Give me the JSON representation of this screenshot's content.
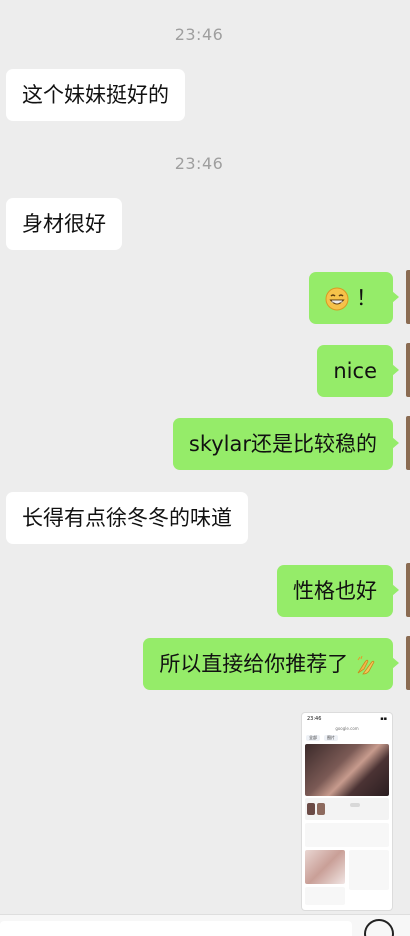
{
  "timestamps": [
    "23:46",
    "23:46"
  ],
  "messages": [
    {
      "side": "in",
      "text": "这个妹妹挺好的"
    },
    {
      "side": "in",
      "text": "身材很好"
    },
    {
      "side": "out",
      "text": "！",
      "emoji": "grinning-face"
    },
    {
      "side": "out",
      "text": "nice"
    },
    {
      "side": "out",
      "text": "skylar还是比较稳的"
    },
    {
      "side": "in",
      "text": "长得有点徐冬冬的味道"
    },
    {
      "side": "out",
      "text": "性格也好"
    },
    {
      "side": "out",
      "text": "所以直接给你推荐了",
      "emoji": "applause-hands"
    }
  ],
  "shared_screenshot": {
    "status_time": "23:46",
    "url": "google.com",
    "tabs": [
      "全部",
      "图片"
    ]
  },
  "colors": {
    "background": "#ededed",
    "incoming_bubble": "#ffffff",
    "outgoing_bubble": "#95ec69",
    "timestamp": "#9f9f9f"
  }
}
